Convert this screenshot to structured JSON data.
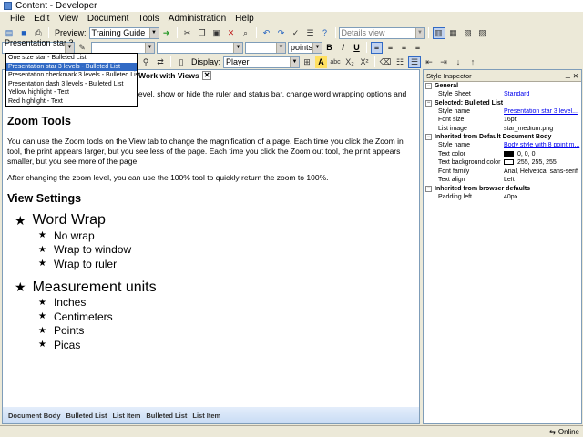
{
  "window": {
    "title": "Content - Developer"
  },
  "menu": [
    "File",
    "Edit",
    "View",
    "Document",
    "Tools",
    "Administration",
    "Help"
  ],
  "toolbar1": {
    "preview_label": "Preview:",
    "preview_value": "Training Guide",
    "view_select": "Details view"
  },
  "toolbar2": {
    "style_select": "Presentation star 3 ...",
    "size_unit": "points"
  },
  "toolbar3": {
    "display_label": "Display:",
    "display_value": "Player"
  },
  "style_dropdown": {
    "options": [
      "One size star - Bulleted List",
      "Presentation star 3 levels - Bulleted List",
      "Presentation checkmark 3 levels - Bulleted List",
      "Presentation dash 3 levels - Bulleted List",
      "Yellow highlight - Text",
      "Red highlight - Text"
    ],
    "selected_index": 1
  },
  "document": {
    "tab_label": "Work with Views",
    "intro_fragment": "level, show or hide the ruler and status bar, change word wrapping options and",
    "zoom_heading": "Zoom Tools",
    "zoom_para1": "You can use the Zoom tools on the View tab to change the magnification of a page. Each time you click the Zoom in tool, the print appears larger, but you see less of the page. Each time you click the Zoom out tool, the print appears smaller, but you see more of the page.",
    "zoom_para2": "After changing the zoom level, you can use the 100% tool to quickly return the zoom to 100%.",
    "view_heading": "View Settings",
    "list": [
      {
        "label": "Word Wrap",
        "children": [
          "No wrap",
          "Wrap to window",
          "Wrap to ruler"
        ]
      },
      {
        "label": "Measurement units",
        "children": [
          "Inches",
          "Centimeters",
          "Points",
          "Picas"
        ]
      }
    ]
  },
  "breadcrumbs": [
    "Document Body",
    "Bulleted List",
    "List Item",
    "Bulleted List",
    "List Item"
  ],
  "inspector": {
    "title": "Style Inspector",
    "general_header": "General",
    "style_sheet_key": "Style Sheet",
    "style_sheet_val": "Standard",
    "selected_header": "Selected: Bulleted List",
    "style_name_key": "Style name",
    "style_name_val": "Presentation star 3 level...",
    "font_size_key": "Font size",
    "font_size_val": "16pt",
    "list_image_key": "List image",
    "list_image_val": "star_medium.png",
    "inherited_header": "Inherited from Default Document Body",
    "inh_style_name_key": "Style name",
    "inh_style_name_val": "Body style with 8 point m...",
    "text_color_key": "Text color",
    "text_color_val": "0, 0, 0",
    "text_color_hex": "#000000",
    "bg_color_key": "Text background color",
    "bg_color_val": "255, 255, 255",
    "bg_color_hex": "#ffffff",
    "font_family_key": "Font family",
    "font_family_val": "Arial, Helvetica, sans-serif",
    "text_align_key": "Text align",
    "text_align_val": "Left",
    "browser_header": "Inherited from browser defaults",
    "padding_left_key": "Padding left",
    "padding_left_val": "40px"
  },
  "status": {
    "online": "Online"
  }
}
